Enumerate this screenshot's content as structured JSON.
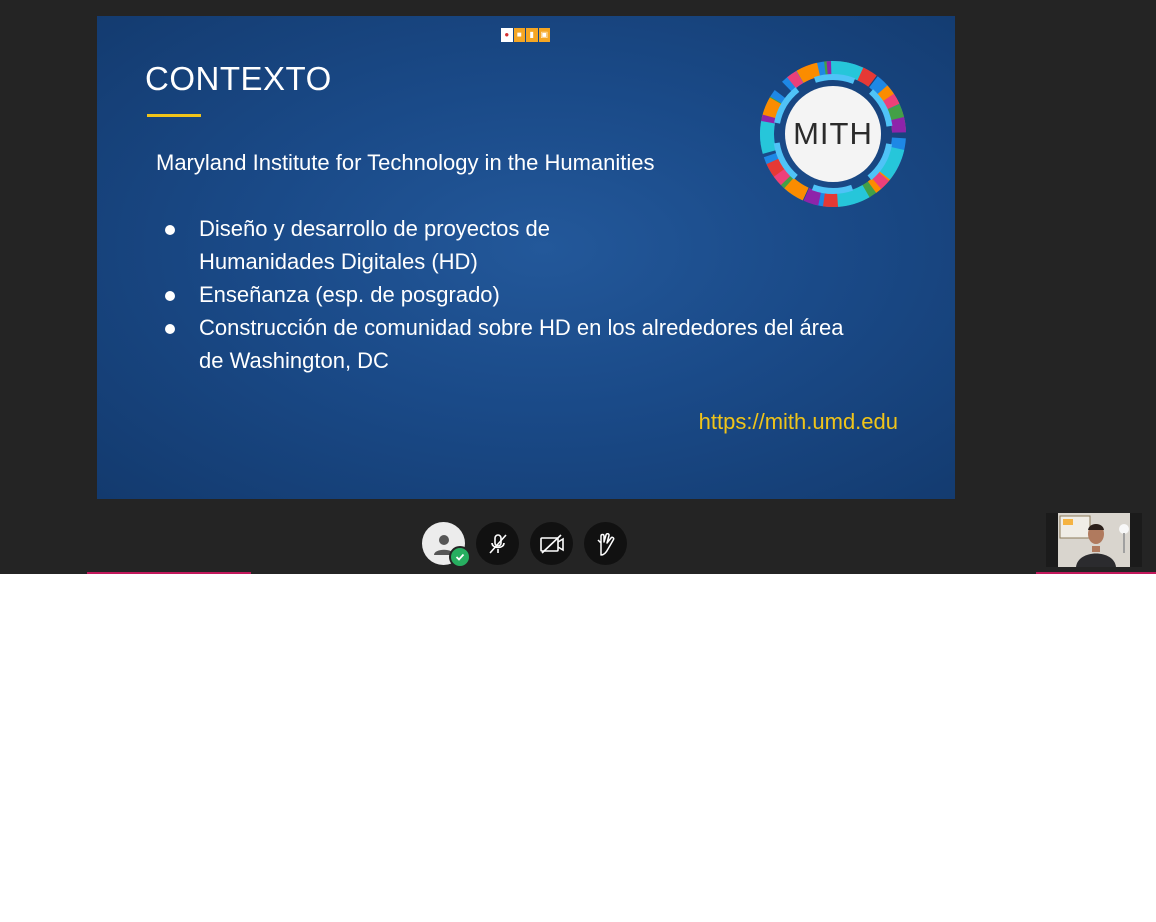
{
  "slide": {
    "title": "CONTEXTO",
    "subtitle": "Maryland Institute for Technology in the Humanities",
    "bullets": [
      {
        "line1": "Diseño y desarrollo de  proyectos de",
        "line2": "Humanidades Digitales (HD)"
      },
      {
        "line1": "Enseñanza (esp. de posgrado)",
        "line2": ""
      },
      {
        "line1": "Construcción de comunidad sobre HD en los alrededores del área",
        "line2": "de Washington, DC"
      }
    ],
    "url": "https://mith.umd.edu",
    "logo_text": "MITH"
  },
  "controls": [
    {
      "name": "user-status-button",
      "icon": "user-icon"
    },
    {
      "name": "mute-microphone-button",
      "icon": "microphone-off-icon"
    },
    {
      "name": "camera-off-button",
      "icon": "camera-off-icon"
    },
    {
      "name": "raise-hand-button",
      "icon": "hand-icon"
    }
  ],
  "colors": {
    "background": "#242424",
    "slide": "#1a4a88",
    "accent_yellow": "#f0c419",
    "status_green": "#27ae60",
    "accent_pink": "#c2185b"
  }
}
